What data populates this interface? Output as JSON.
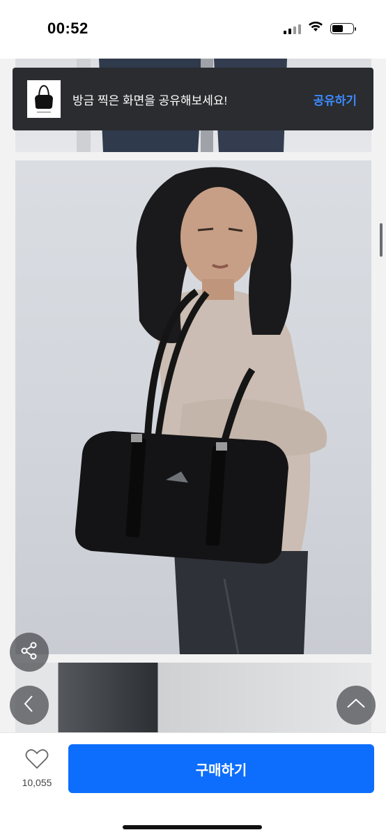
{
  "status_bar": {
    "time": "00:52",
    "icons": [
      "cellular-signal-icon",
      "wifi-icon",
      "battery-icon"
    ]
  },
  "toast": {
    "thumbnail": "bag-thumbnail",
    "message": "방금 찍은 화면을 공유해보세요!",
    "action_label": "공유하기",
    "action_color": "#3d8bff",
    "background": "#2a2c2f"
  },
  "gallery": {
    "images": [
      "product-photo-top",
      "product-photo-model-with-bag",
      "product-photo-bottom"
    ]
  },
  "floating_buttons": {
    "share": "share-icon",
    "back": "chevron-left-icon",
    "scroll_top": "chevron-up-icon"
  },
  "bottom_bar": {
    "like_icon": "heart-icon",
    "like_count": "10,055",
    "buy_label": "구매하기",
    "buy_color": "#0d6efd"
  }
}
